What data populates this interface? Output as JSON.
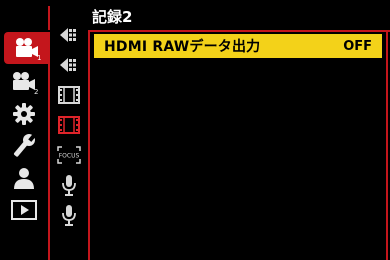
{
  "header": {
    "title": "記録2"
  },
  "menu": {
    "items": [
      {
        "label": "HDMI RAWデータ出力",
        "value": "OFF"
      }
    ]
  },
  "tabs": [
    {
      "name": "video-camera",
      "active": true
    },
    {
      "name": "video-camera-2",
      "active": false
    },
    {
      "name": "settings",
      "active": false
    },
    {
      "name": "custom",
      "active": false
    },
    {
      "name": "my-menu",
      "active": false
    },
    {
      "name": "playback",
      "active": false
    }
  ],
  "subtabs": [
    "record-1",
    "record-2",
    "film-1",
    "film-2-active",
    "focus",
    "mic-1",
    "mic-2"
  ],
  "colors": {
    "accent": "#c4161c",
    "highlight": "#f3d219",
    "icon": "#e8e8e8"
  },
  "labels": {
    "tab2_sub": "2",
    "focus_text": "FOCUS"
  }
}
